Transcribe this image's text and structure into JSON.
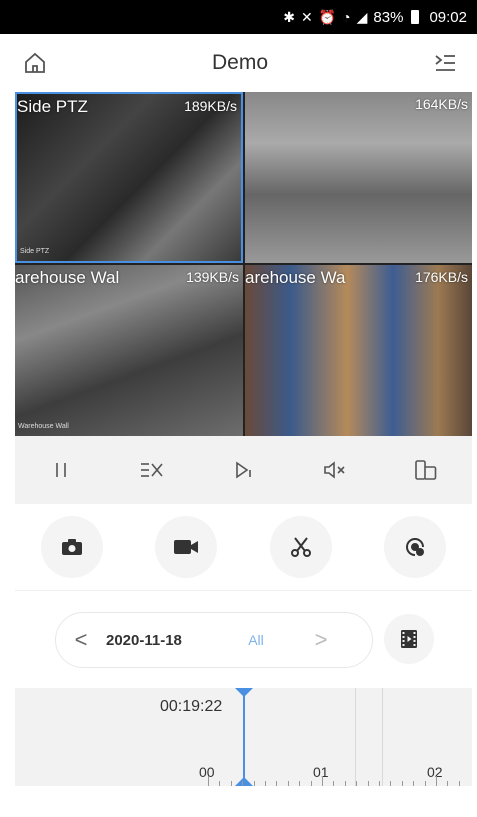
{
  "status_bar": {
    "battery_percent": "83%",
    "time": "09:02"
  },
  "navbar": {
    "title": "Demo",
    "home_icon": "home-icon",
    "menu_icon": "list-menu-icon"
  },
  "grid": {
    "tiles": [
      {
        "name": "Side PTZ",
        "rate": "189KB/s",
        "osd": "Side PTZ"
      },
      {
        "name": "",
        "rate": "164KB/s",
        "osd": ""
      },
      {
        "name": "arehouse Wal",
        "rate": "139KB/s",
        "osd": "Warehouse Wall"
      },
      {
        "name": "arehouse Wa",
        "rate": "176KB/s",
        "osd": ""
      }
    ]
  },
  "toolbar": {
    "icons": [
      "pause-icon",
      "split-close-icon",
      "next-frame-icon",
      "mute-icon",
      "fullscreen-rotate-icon"
    ]
  },
  "actions": {
    "icons": [
      "camera-icon",
      "video-record-icon",
      "clip-icon",
      "playback-speed-icon"
    ]
  },
  "date_bar": {
    "prev": "<",
    "date": "2020-11-18",
    "filter": "All",
    "next": ">"
  },
  "timeline": {
    "current_time": "00:19:22",
    "hours": [
      "00",
      "01",
      "02"
    ]
  },
  "colors": {
    "accent": "#4a90e2",
    "filter_text": "#7fb2ea",
    "toolbar_bg": "#f2f2f2"
  }
}
